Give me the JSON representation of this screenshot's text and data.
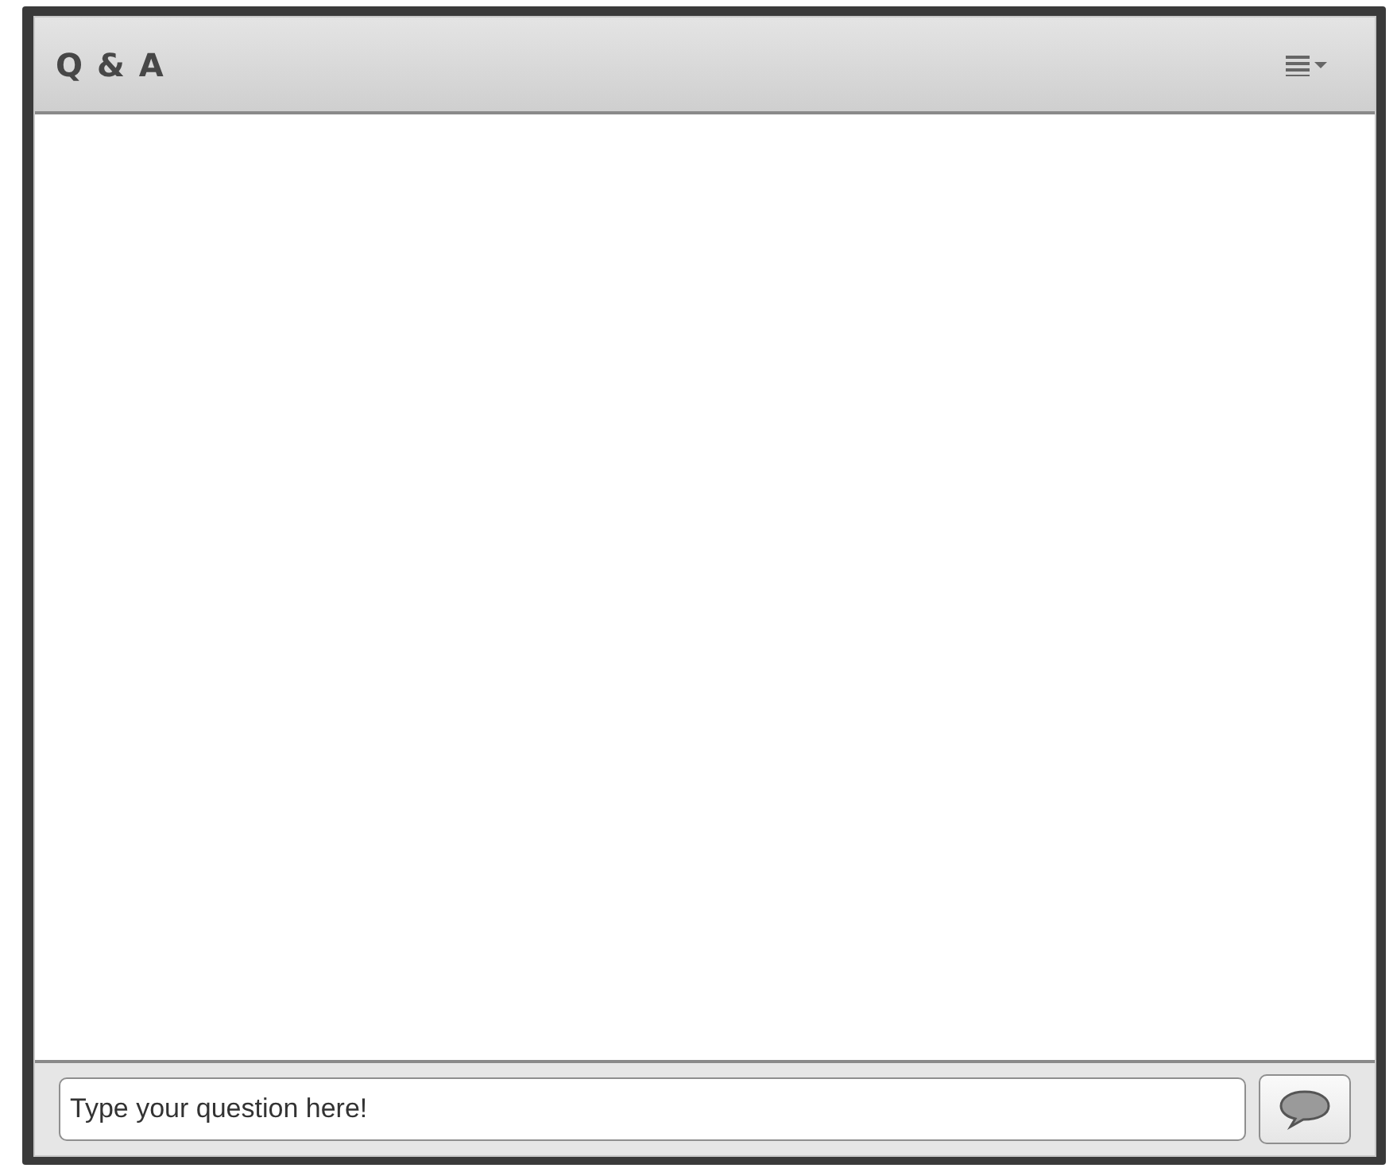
{
  "panel": {
    "title": "Q & A"
  },
  "question_input": {
    "placeholder": "Type your question here!"
  }
}
